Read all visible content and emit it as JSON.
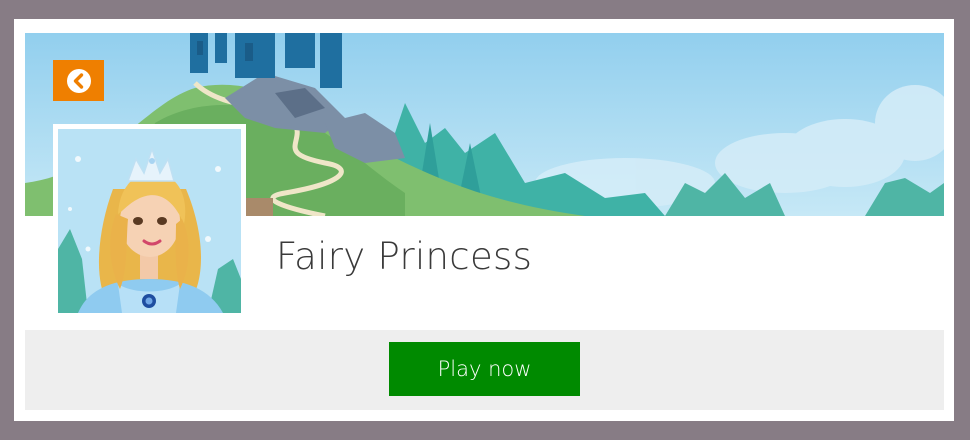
{
  "game": {
    "title": "Fairy Princess",
    "play_label": "Play now"
  },
  "icons": {
    "back": "chevron-left-icon"
  },
  "colors": {
    "page_frame": "#877c85",
    "back_button": "#ef7f00",
    "play_button": "#008a00",
    "footer_bar": "#eeeeee",
    "sky": "#a9d8ef"
  }
}
